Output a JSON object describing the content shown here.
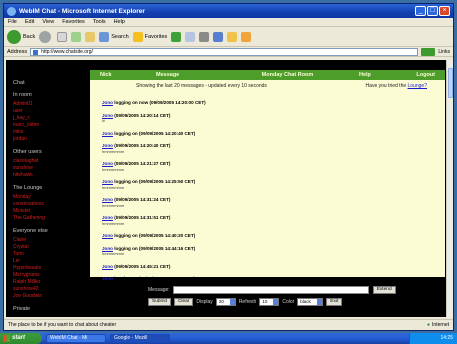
{
  "window": {
    "title": "WebIM Chat - Microsoft Internet Explorer",
    "buttons": [
      "_",
      "□",
      "×"
    ]
  },
  "menubar": [
    "File",
    "Edit",
    "View",
    "Favorites",
    "Tools",
    "Help"
  ],
  "toolbar": {
    "back": "Back",
    "search": "Search",
    "favorites": "Favorites"
  },
  "addressbar": {
    "label": "Address",
    "url": "http://www.chatsite.org/",
    "go": "Go",
    "links": "Links"
  },
  "sidebar": {
    "sections": [
      {
        "heading": "Chat",
        "items": []
      },
      {
        "heading": "In room",
        "items": [
          "Admin01",
          "user",
          "j_kay_c",
          "marc_olden",
          "mike",
          "jordan"
        ]
      },
      {
        "heading": "Other users",
        "items": [
          "clairelaghet",
          "sunshine",
          "nitehawk"
        ]
      },
      {
        "heading": "The Lounge",
        "items": [
          "Monday",
          "conversations",
          "Minister",
          "The Gathering"
        ]
      },
      {
        "heading": "Everyone else",
        "items": [
          "Claire",
          "Crystal",
          "Tomi",
          "Lei",
          "Hyperbeasts",
          "Merrygrams",
          "Ralph Milller",
          "sunshine42",
          "Joe Goodwin"
        ]
      },
      {
        "heading": "Private",
        "items": []
      }
    ]
  },
  "main": {
    "header": {
      "c1": "Nick",
      "c2": "Message",
      "c3": "Monday Chat Room",
      "c4": "Help",
      "c5": "Logout"
    },
    "info": {
      "left": "Showing the last 20 messages - updated every 10 seconds",
      "right_text": "Have you tried the",
      "right_link": "Lounge?"
    },
    "messages": [
      {
        "who": "Jono",
        "text": "logging on now",
        "time": "(09/09/2005 14:20:00 CET)",
        "sub": ""
      },
      {
        "who": "Jono",
        "text": "",
        "time": "(09/09/2005 14:20:14 CET)",
        "sub": "hi"
      },
      {
        "who": "Jono",
        "text": "logging on",
        "time": "(09/09/2005 14:20:40 CET)",
        "sub": ""
      },
      {
        "who": "Jono",
        "text": "",
        "time": "(09/09/2005 14:20:40 CET)",
        "sub": "hmmmmmm"
      },
      {
        "who": "Jono",
        "text": "",
        "time": "(09/09/2005 14:21:27 CET)",
        "sub": "hmmmmmm"
      },
      {
        "who": "Jono",
        "text": "logging on",
        "time": "(09/09/2005 14:25:50 CET)",
        "sub": "hmmmmmm"
      },
      {
        "who": "Jono",
        "text": "",
        "time": "(09/09/2005 14:31:24 CET)",
        "sub": "hmmmmmm"
      },
      {
        "who": "Jono",
        "text": "",
        "time": "(09/09/2005 14:31:51 CET)",
        "sub": "hmmmmmm"
      },
      {
        "who": "Jono",
        "text": "logging on",
        "time": "(09/09/2005 14:40:20 CET)",
        "sub": ""
      },
      {
        "who": "Jono",
        "text": "logging on",
        "time": "(09/09/2005 14:44:16 CET)",
        "sub": "hmmmmmm"
      },
      {
        "who": "Jono",
        "text": "",
        "time": "(09/09/2005 14:45:21 CET)",
        "sub": ""
      },
      {
        "who": "Jono",
        "text": "logging on",
        "time": "(09/09/2005 14:50:11 CET)",
        "sub": ""
      },
      {
        "who": "Claude",
        "text": "",
        "time": "(09/09/2005 15:14:20 CET)",
        "sub": "hello"
      }
    ]
  },
  "form": {
    "message_label": "Message:",
    "submit": "Submit",
    "clear": "Clear",
    "display_label": "Display",
    "display_value": "20",
    "refresh_label": "Refresh",
    "refresh_value": "10",
    "colour_label": "Color",
    "colour_value": "black",
    "exit": "Exit",
    "extend": "Extend"
  },
  "statusbar": {
    "text": "The place to be if you want to chat about cheater",
    "zone": "Internet"
  },
  "taskbar": {
    "start": "start",
    "tasks": [
      "WebIM Chat - Mi",
      "Google - Mozill"
    ],
    "clock": "14:25"
  },
  "colors": {
    "accent_green": "#4c9d2a",
    "chat_bg": "#fcfcd4",
    "link_red": "#d81e1e"
  }
}
